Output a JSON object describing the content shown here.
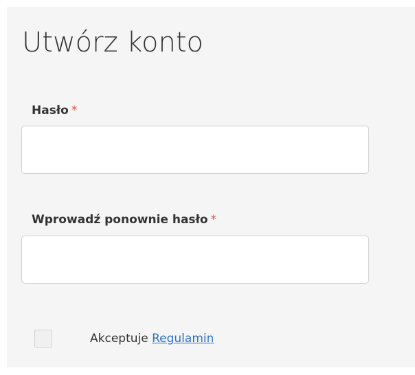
{
  "form": {
    "title": "Utwórz konto",
    "required_marker": "*",
    "password": {
      "label": "Hasło",
      "value": "",
      "placeholder": ""
    },
    "confirm_password": {
      "label": "Wprowadź ponownie hasło",
      "value": "",
      "placeholder": ""
    },
    "terms": {
      "checked": false,
      "prefix": "Akceptuje",
      "link_text": "Regulamin"
    }
  },
  "colors": {
    "panel_background": "#f5f5f5",
    "required_marker": "#d9534f",
    "link": "#2a6fc9",
    "text": "#333333"
  }
}
